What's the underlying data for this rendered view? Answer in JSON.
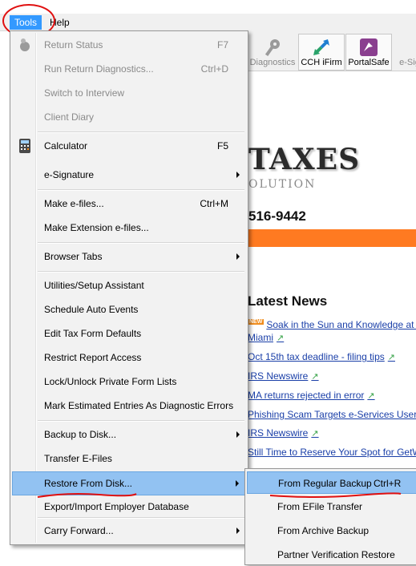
{
  "menubar": {
    "tools_label": "Tools",
    "help_label": "Help"
  },
  "toolbar": {
    "diagnostics_label": "Diagnostics",
    "cch_ifirm_label": "CCH iFirm",
    "portalsafe_label": "PortalSafe",
    "esig_label": "e-Sig"
  },
  "brand": {
    "title": "TAXES",
    "subtitle": "OLUTION",
    "phone": "516-9442"
  },
  "news": {
    "heading": "Latest News",
    "new_badge": "NEW",
    "items": [
      "Soak in the Sun and Knowledge at C",
      "Miami",
      "Oct 15th tax deadline - filing tips",
      "IRS Newswire",
      "MA returns rejected in error",
      "Phishing Scam Targets e-Services Users",
      "IRS Newswire",
      "Still Time to Reserve Your Spot for GetW"
    ]
  },
  "tools_menu": {
    "items": [
      {
        "label": "Return Status",
        "shortcut": "F7",
        "disabled": true
      },
      {
        "label": "Run Return Diagnostics...",
        "shortcut": "Ctrl+D",
        "disabled": true
      },
      {
        "label": "Switch to Interview",
        "shortcut": "",
        "disabled": true
      },
      {
        "label": "Client Diary",
        "shortcut": "",
        "disabled": true
      },
      {
        "label": "Calculator",
        "shortcut": "F5"
      },
      {
        "label": "e-Signature",
        "shortcut": "",
        "submenu": true
      },
      {
        "label": "Make e-files...",
        "shortcut": "Ctrl+M"
      },
      {
        "label": "Make Extension e-files...",
        "shortcut": ""
      },
      {
        "label": "Browser Tabs",
        "shortcut": "",
        "submenu": true
      },
      {
        "label": "Utilities/Setup Assistant",
        "shortcut": ""
      },
      {
        "label": "Schedule Auto Events",
        "shortcut": ""
      },
      {
        "label": "Edit Tax Form Defaults",
        "shortcut": ""
      },
      {
        "label": "Restrict Report Access",
        "shortcut": ""
      },
      {
        "label": "Lock/Unlock Private Form Lists",
        "shortcut": ""
      },
      {
        "label": "Mark Estimated Entries As Diagnostic Errors",
        "shortcut": ""
      },
      {
        "label": "Backup to Disk...",
        "shortcut": "",
        "submenu": true
      },
      {
        "label": "Transfer E-Files",
        "shortcut": ""
      },
      {
        "label": "Restore From Disk...",
        "shortcut": "",
        "submenu": true,
        "highlighted": true
      },
      {
        "label": "Export/Import Employer Database",
        "shortcut": ""
      },
      {
        "label": "Carry Forward...",
        "shortcut": "",
        "submenu": true
      }
    ]
  },
  "restore_submenu": {
    "items": [
      {
        "label": "From Regular Backup",
        "shortcut": "Ctrl+R",
        "highlighted": true
      },
      {
        "label": "From EFile Transfer",
        "shortcut": ""
      },
      {
        "label": "From Archive Backup",
        "shortcut": ""
      },
      {
        "label": "Partner Verification Restore",
        "shortcut": ""
      }
    ]
  },
  "colors": {
    "menu_bg": "#f2f2f2",
    "highlight": "#92c2f2",
    "menubar_active": "#3399ff",
    "annotation_red": "#e01010",
    "orange_bar": "#ff7a21",
    "link_blue": "#1a3fa8"
  }
}
